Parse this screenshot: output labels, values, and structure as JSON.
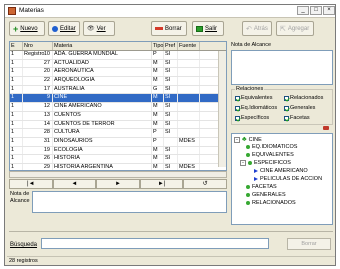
{
  "window": {
    "title": "Materias",
    "minimize": "_",
    "maximize": "□",
    "close": "×"
  },
  "toolbar": {
    "new_label": "Nuevo",
    "edit_label": "Editar",
    "view_label": "Ver",
    "delete_label": "Borrar",
    "exit_label": "Salir",
    "back_label": "Atrás",
    "add_label": "Agregar"
  },
  "grid": {
    "headers": [
      "E",
      "Nro Registro",
      "Materia",
      "Tipo",
      "Pref",
      "Fuente"
    ],
    "rows": [
      [
        "1",
        "10",
        "ADA. GUERRA MUNDIAL",
        "P",
        "SI",
        ""
      ],
      [
        "1",
        "27",
        "ACTUALIDAD",
        "M",
        "SI",
        ""
      ],
      [
        "1",
        "20",
        "AERONAUTICA",
        "M",
        "SI",
        ""
      ],
      [
        "1",
        "22",
        "ARQUEOLOGIA",
        "M",
        "SI",
        ""
      ],
      [
        "1",
        "17",
        "AUSTRALIA",
        "G",
        "SI",
        ""
      ],
      [
        "1",
        "9",
        "CINE",
        "M",
        "SI",
        ""
      ],
      [
        "1",
        "12",
        "CINE AMERICANO",
        "M",
        "SI",
        ""
      ],
      [
        "1",
        "13",
        "CUENTOS",
        "M",
        "SI",
        ""
      ],
      [
        "1",
        "14",
        "CUENTOS DE TERROR",
        "M",
        "SI",
        ""
      ],
      [
        "1",
        "28",
        "CULTURA",
        "P",
        "SI",
        ""
      ],
      [
        "1",
        "31",
        "DINOSAURIOS",
        "P",
        "",
        "MDES"
      ],
      [
        "1",
        "19",
        "ECOLOGIA",
        "M",
        "SI",
        ""
      ],
      [
        "1",
        "26",
        "HISTORIA",
        "M",
        "SI",
        ""
      ],
      [
        "1",
        "29",
        "HISTORIA ARGENTINA",
        "M",
        "SI",
        "MDES"
      ],
      [
        "1",
        "8",
        "INVESTIGACION CIENTIFICA",
        "M",
        "SI",
        ""
      ]
    ],
    "selected_row": 5
  },
  "navigator": {
    "first": "|◄",
    "prev": "◄",
    "next": "►",
    "last": "►|",
    "refresh": "↺"
  },
  "note": {
    "label": "Nota de Alcance"
  },
  "alcance": {
    "label": "Nota de Alcance"
  },
  "relaciones": {
    "label": "Relaciones",
    "items": [
      "Equivalentes",
      "Relacionados",
      "Eq.Idiomáticos",
      "Generales",
      "Específicos",
      "Facetas"
    ]
  },
  "tree": {
    "root": "CINE",
    "nodes": [
      "EQ.IDIOMATICOS",
      "EQUIVALENTES",
      "ESPECIFICOS",
      "CINE AMERICANO",
      "PELICULAS DE ACCION",
      "FACETAS",
      "GENERALES",
      "RELACIONADOS"
    ]
  },
  "search": {
    "label": "Búsqueda",
    "value": "",
    "clear_label": "Borrar"
  },
  "status": {
    "text": "28 registros"
  },
  "colors": {
    "selection": "#316ac5",
    "accent_green": "#36a832",
    "accent_blue": "#1f3fd0",
    "delete_red": "#d43a2a"
  }
}
